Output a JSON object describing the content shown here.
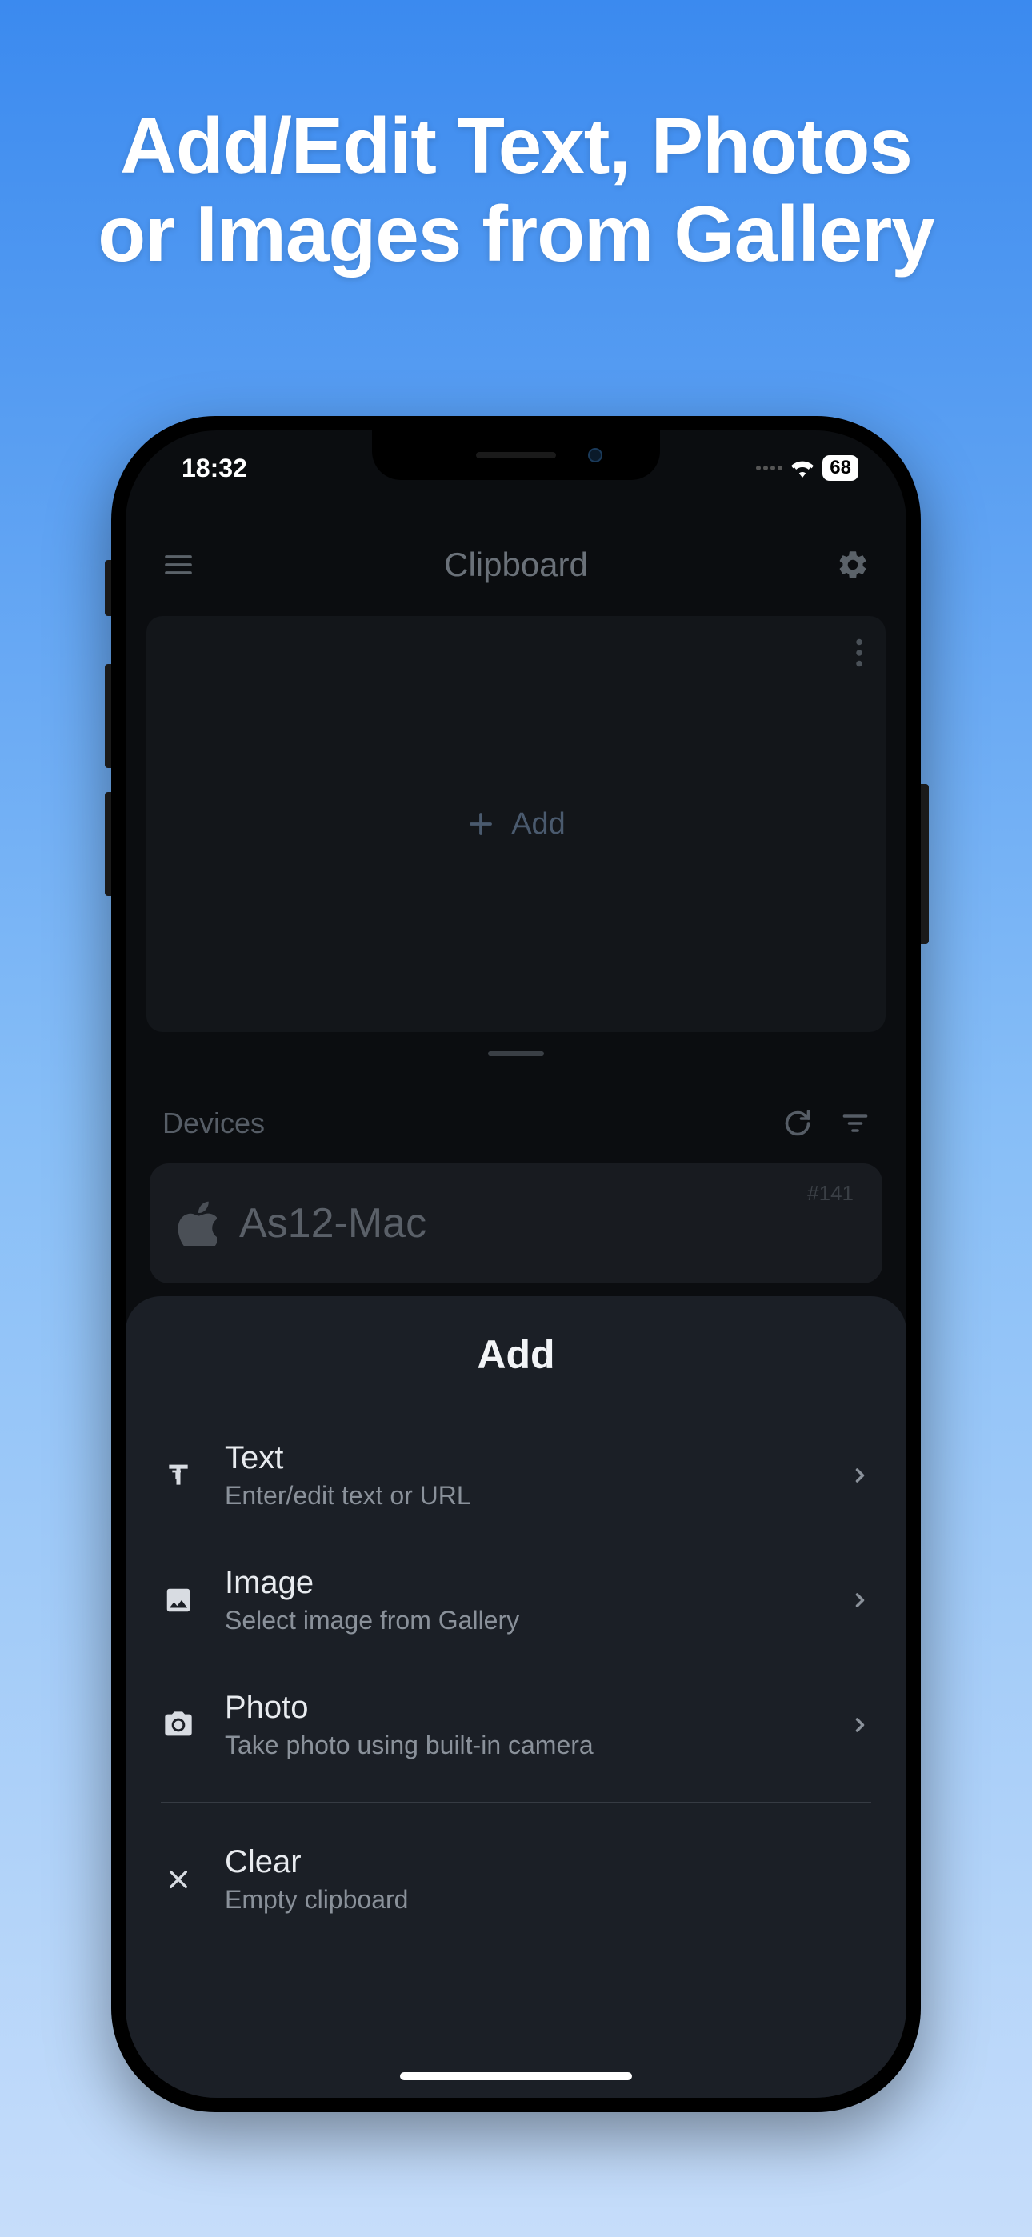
{
  "marketing": {
    "title_line1": "Add/Edit Text, Photos",
    "title_line2": "or Images from Gallery"
  },
  "status_bar": {
    "time": "18:32",
    "battery": "68"
  },
  "header": {
    "title": "Clipboard"
  },
  "add_card": {
    "button_label": "Add"
  },
  "devices": {
    "section_label": "Devices",
    "items": [
      {
        "name": "As12-Mac",
        "number": "#141"
      }
    ]
  },
  "sheet": {
    "title": "Add",
    "items": [
      {
        "title": "Text",
        "subtitle": "Enter/edit text or URL"
      },
      {
        "title": "Image",
        "subtitle": "Select image from Gallery"
      },
      {
        "title": "Photo",
        "subtitle": "Take photo using built-in camera"
      }
    ],
    "clear": {
      "title": "Clear",
      "subtitle": "Empty clipboard"
    }
  }
}
